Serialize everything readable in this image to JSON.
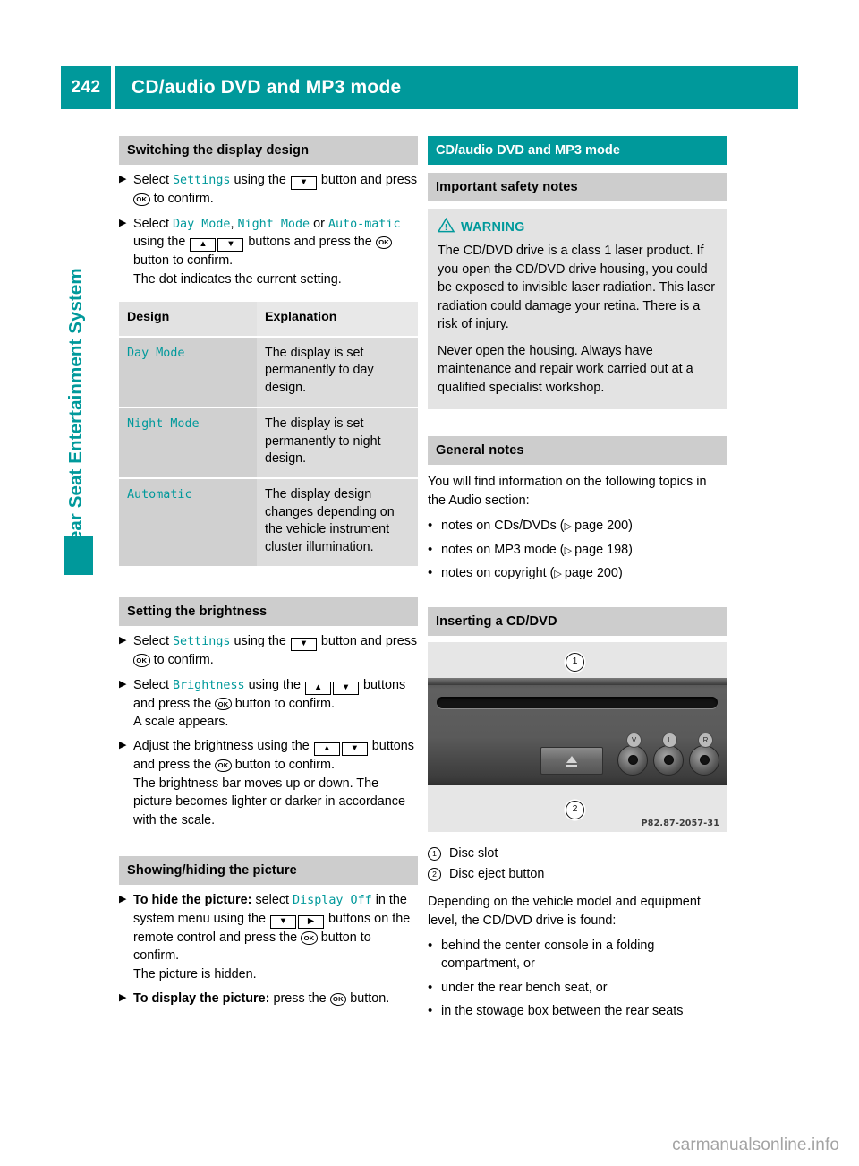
{
  "header": {
    "page_number": "242",
    "title": "CD/audio DVD and MP3 mode"
  },
  "side_tab": {
    "label": "Rear Seat Entertainment System"
  },
  "colors": {
    "teal": "#00999b",
    "gray_heading": "#cdcdcd",
    "warning_bg": "#e3e3e3"
  },
  "left_column": {
    "section_switching_display": {
      "heading": "Switching the display design",
      "steps": [
        {
          "parts": [
            {
              "t": "text",
              "v": "Select "
            },
            {
              "t": "ui",
              "v": "Settings"
            },
            {
              "t": "text",
              "v": " using the "
            },
            {
              "t": "key",
              "v": "▼"
            },
            {
              "t": "text",
              "v": " button and press "
            },
            {
              "t": "ok",
              "v": "OK"
            },
            {
              "t": "text",
              "v": " to confirm."
            }
          ]
        },
        {
          "parts": [
            {
              "t": "text",
              "v": "Select "
            },
            {
              "t": "ui",
              "v": "Day Mode"
            },
            {
              "t": "text",
              "v": ", "
            },
            {
              "t": "ui",
              "v": "Night Mode"
            },
            {
              "t": "text",
              "v": " or "
            },
            {
              "t": "ui",
              "v": "Auto‑matic"
            },
            {
              "t": "text",
              "v": " using the "
            },
            {
              "t": "key",
              "v": "▲"
            },
            {
              "t": "key",
              "v": "▼"
            },
            {
              "t": "text",
              "v": " buttons and press the "
            },
            {
              "t": "ok",
              "v": "OK"
            },
            {
              "t": "text",
              "v": " button to confirm."
            },
            {
              "t": "br",
              "v": ""
            },
            {
              "t": "text",
              "v": "The dot indicates the current setting."
            }
          ]
        }
      ],
      "table": {
        "headers": [
          "Design",
          "Explanation"
        ],
        "rows": [
          {
            "design": "Day Mode",
            "explanation": "The display is set permanently to day design."
          },
          {
            "design": "Night Mode",
            "explanation": "The display is set permanently to night design."
          },
          {
            "design": "Automatic",
            "explanation": "The display design changes depending on the vehicle instrument cluster illumination."
          }
        ]
      }
    },
    "section_brightness": {
      "heading": "Setting the brightness",
      "steps": [
        {
          "parts": [
            {
              "t": "text",
              "v": "Select "
            },
            {
              "t": "ui",
              "v": "Settings"
            },
            {
              "t": "text",
              "v": " using the "
            },
            {
              "t": "key",
              "v": "▼"
            },
            {
              "t": "text",
              "v": " button and press "
            },
            {
              "t": "ok",
              "v": "OK"
            },
            {
              "t": "text",
              "v": " to confirm."
            }
          ]
        },
        {
          "parts": [
            {
              "t": "text",
              "v": "Select "
            },
            {
              "t": "ui",
              "v": "Brightness"
            },
            {
              "t": "text",
              "v": " using the "
            },
            {
              "t": "key",
              "v": "▲"
            },
            {
              "t": "key",
              "v": "▼"
            },
            {
              "t": "text",
              "v": " buttons and press the "
            },
            {
              "t": "ok",
              "v": "OK"
            },
            {
              "t": "text",
              "v": " button to confirm."
            },
            {
              "t": "br",
              "v": ""
            },
            {
              "t": "text",
              "v": "A scale appears."
            }
          ]
        },
        {
          "parts": [
            {
              "t": "text",
              "v": "Adjust the brightness using the "
            },
            {
              "t": "key",
              "v": "▲"
            },
            {
              "t": "key",
              "v": "▼"
            },
            {
              "t": "text",
              "v": " buttons and press the "
            },
            {
              "t": "ok",
              "v": "OK"
            },
            {
              "t": "text",
              "v": " button to confirm."
            },
            {
              "t": "br",
              "v": ""
            },
            {
              "t": "text",
              "v": "The brightness bar moves up or down. The picture becomes lighter or darker in accordance with the scale."
            }
          ]
        }
      ]
    },
    "section_showing_hiding": {
      "heading": "Showing/hiding the picture",
      "steps": [
        {
          "parts": [
            {
              "t": "bold",
              "v": "To hide the picture:"
            },
            {
              "t": "text",
              "v": " select "
            },
            {
              "t": "ui",
              "v": "Display Off"
            },
            {
              "t": "text",
              "v": " in the system menu using the "
            },
            {
              "t": "key",
              "v": "▼"
            },
            {
              "t": "key",
              "v": "▶"
            },
            {
              "t": "text",
              "v": " buttons on the remote control and press the "
            },
            {
              "t": "ok",
              "v": "OK"
            },
            {
              "t": "text",
              "v": " button to confirm."
            },
            {
              "t": "br",
              "v": ""
            },
            {
              "t": "text",
              "v": "The picture is hidden."
            }
          ]
        },
        {
          "parts": [
            {
              "t": "bold",
              "v": "To display the picture:"
            },
            {
              "t": "text",
              "v": " press the "
            },
            {
              "t": "ok",
              "v": "OK"
            },
            {
              "t": "text",
              "v": " button."
            }
          ]
        }
      ]
    }
  },
  "right_column": {
    "chapter_title": "CD/audio DVD and MP3 mode",
    "section_safety": {
      "heading": "Important safety notes",
      "warning_label": "WARNING",
      "paragraphs": [
        "The CD/DVD drive is a class 1 laser product. If you open the CD/DVD drive housing, you could be exposed to invisible laser radiation. This laser radiation could damage your retina. There is a risk of injury.",
        "Never open the housing. Always have maintenance and repair work carried out at a qualified specialist workshop."
      ]
    },
    "section_general": {
      "heading": "General notes",
      "intro": "You will find information on the following topics in the Audio section:",
      "bullets": [
        {
          "text": "notes on CDs/DVDs (",
          "ref": "page 200",
          "close": ")"
        },
        {
          "text": "notes on MP3 mode (",
          "ref": "page 198",
          "close": ")"
        },
        {
          "text": "notes on copyright (",
          "ref": "page 200",
          "close": ")"
        }
      ]
    },
    "section_inserting": {
      "heading": "Inserting a CD/DVD",
      "figure_code": "P82.87-2057-31",
      "callouts": [
        {
          "num": "1",
          "label": "Disc slot"
        },
        {
          "num": "2",
          "label": "Disc eject button"
        }
      ],
      "body": "Depending on the vehicle model and equipment level, the CD/DVD drive is found:",
      "bullets": [
        "behind the center console in a folding compartment, or",
        "under the rear bench seat, or",
        "in the stowage box between the rear seats"
      ]
    }
  },
  "watermark": "carmanualsonline.info"
}
